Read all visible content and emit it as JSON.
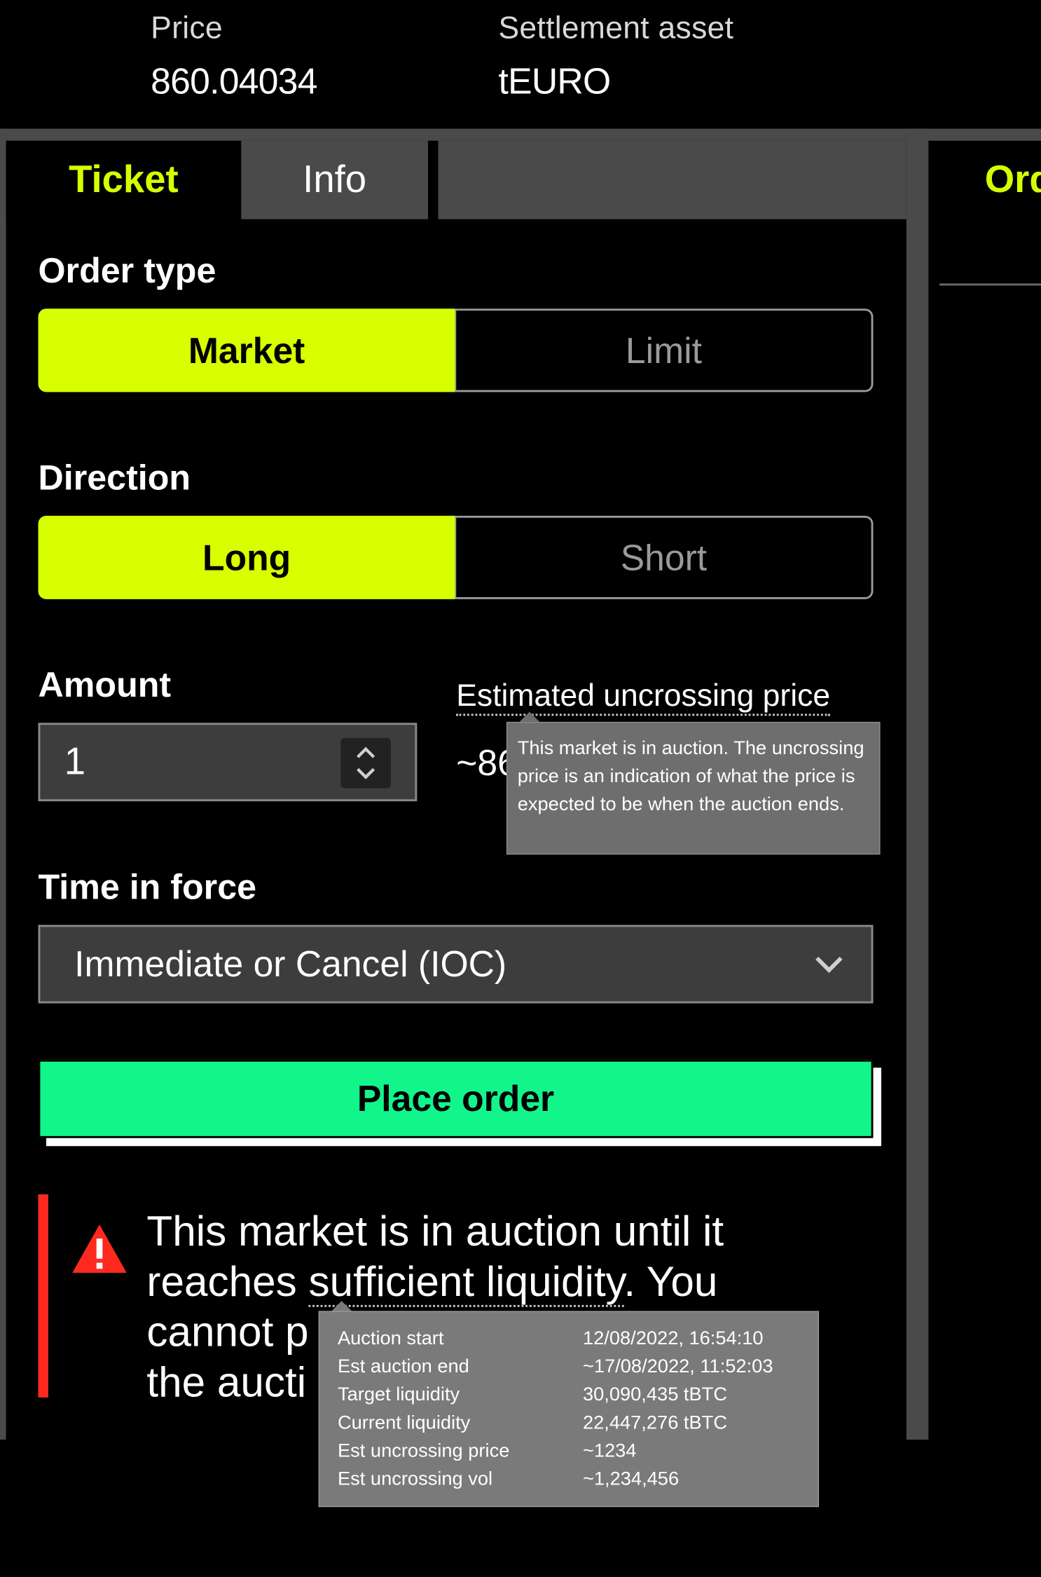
{
  "header": {
    "price_label": "Price",
    "price_value": "860.04034",
    "settlement_label": "Settlement asset",
    "settlement_value": "tEURO"
  },
  "tabs": {
    "ticket": "Ticket",
    "info": "Info",
    "right_partial": "Ord"
  },
  "order_type": {
    "label": "Order type",
    "options": [
      "Market",
      "Limit"
    ],
    "selected": "Market"
  },
  "direction": {
    "label": "Direction",
    "options": [
      "Long",
      "Short"
    ],
    "selected": "Long"
  },
  "amount": {
    "label": "Amount",
    "value": "1"
  },
  "estimate": {
    "label": "Estimated uncrossing price",
    "value_partial": "~86",
    "tooltip": "This market is in auction. The uncrossing price is an indication of what the price is expected to be when the auction ends."
  },
  "time_in_force": {
    "label": "Time in force",
    "selected": "Immediate or Cancel (IOC)"
  },
  "place_order": "Place order",
  "alert": {
    "line1": "This market is in auction until it",
    "line2_pre": "reaches ",
    "line2_link": "sufficient liquidity",
    "line2_post": ". You",
    "line3": "cannot p",
    "line4": "the aucti"
  },
  "auction_tooltip": [
    {
      "k": "Auction start",
      "v": " 12/08/2022, 16:54:10"
    },
    {
      "k": "Est auction end",
      "v": "~17/08/2022, 11:52:03"
    },
    {
      "k": "Target liquidity",
      "v": " 30,090,435 tBTC"
    },
    {
      "k": "Current liquidity",
      "v": " 22,447,276 tBTC"
    },
    {
      "k": "Est uncrossing price",
      "v": "~1234"
    },
    {
      "k": "Est uncrossing vol",
      "v": "~1,234,456"
    }
  ],
  "colors": {
    "accent": "#d7ff00",
    "place_order": "#12f58a",
    "alert": "#ff2a1f"
  }
}
